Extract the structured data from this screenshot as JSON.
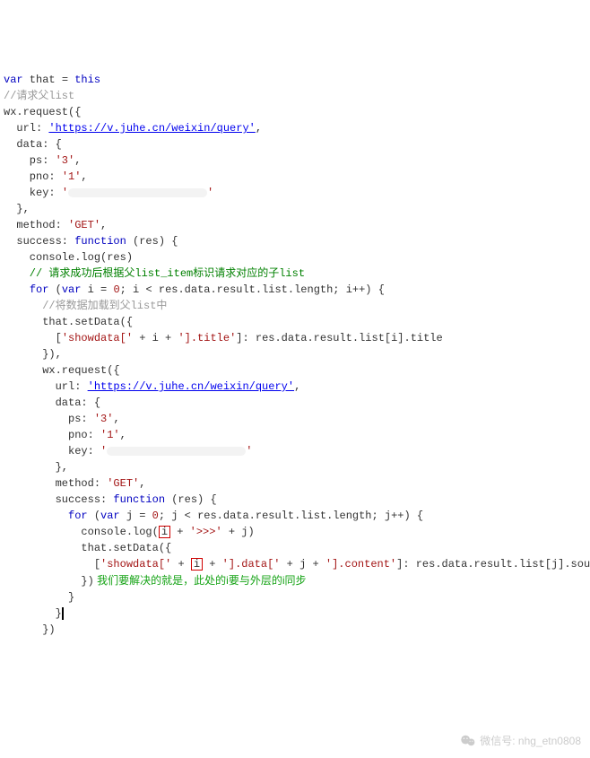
{
  "code": {
    "l1_var": "var",
    "l1_that": " that = ",
    "l1_this": "this",
    "l2": "//请求父list",
    "l3": "wx.request({",
    "l4_a": "  url: ",
    "l4_url": "'https://v.juhe.cn/weixin/query'",
    "l4_b": ",",
    "l5": "  data: {",
    "l6_a": "    ps: ",
    "l6_b": "'3'",
    "l6_c": ",",
    "l7_a": "    pno: ",
    "l7_b": "'1'",
    "l7_c": ",",
    "l8_a": "    key: ",
    "l8_b": "'",
    "l8_c": "'",
    "l9": "  },",
    "l10_a": "  method: ",
    "l10_b": "'GET'",
    "l10_c": ",",
    "l11_a": "  success: ",
    "l11_b": "function",
    "l11_c": " (res) {",
    "l12": "    console.log(res)",
    "l13": "    // 请求成功后根据父list_item标识请求对应的子list",
    "l14_a": "    ",
    "l14_b": "for",
    "l14_c": " (",
    "l14_d": "var",
    "l14_e": " i = ",
    "l14_f": "0",
    "l14_g": "; i < res.data.result.list.length; i++) {",
    "l15": "      //将数据加载到父list中",
    "l16": "      that.setData({",
    "l17_a": "        [",
    "l17_b": "'showdata['",
    "l17_c": " + i + ",
    "l17_d": "'].title'",
    "l17_e": "]: res.data.result.list[i].title",
    "l18": "      }),",
    "l19": "      wx.request({",
    "l20_a": "        url: ",
    "l20_url": "'https://v.juhe.cn/weixin/query'",
    "l20_b": ",",
    "l21": "        data: {",
    "l22_a": "          ps: ",
    "l22_b": "'3'",
    "l22_c": ",",
    "l23_a": "          pno: ",
    "l23_b": "'1'",
    "l23_c": ",",
    "l24_a": "          key: ",
    "l24_b": "'",
    "l24_c": "'",
    "l25": "        },",
    "l26_a": "        method: ",
    "l26_b": "'GET'",
    "l26_c": ",",
    "l27_a": "        success: ",
    "l27_b": "function",
    "l27_c": " (res) {",
    "l28_a": "          ",
    "l28_b": "for",
    "l28_c": " (",
    "l28_d": "var",
    "l28_e": " j = ",
    "l28_f": "0",
    "l28_g": "; j < res.data.result.list.length; j++) {",
    "l29_a": "            console.log(",
    "l29_i": "i",
    "l29_b": " + ",
    "l29_c": "'>>>'",
    "l29_d": " + j)",
    "l30": "            that.setData({",
    "l31_a": "              [",
    "l31_b": "'showdata['",
    "l31_c": " + ",
    "l31_i": "i",
    "l31_d": " + ",
    "l31_e": "'].data['",
    "l31_f": " + j + ",
    "l31_g": "'].content'",
    "l31_h": "]: res.data.result.list[j].source",
    "l32_a": "            })",
    "l32_anno": " 我们要解决的就是，此处的i要与外层的i同步",
    "l33": "          }",
    "l34": "        }",
    "l35": "      })"
  },
  "watermark": "微信号: nhg_etn0808"
}
